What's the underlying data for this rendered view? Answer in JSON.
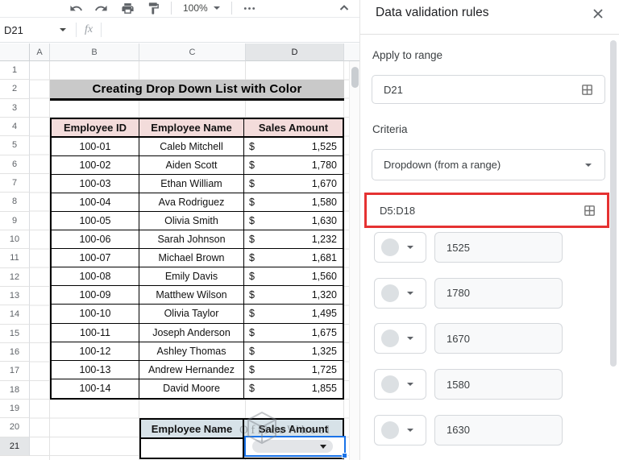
{
  "toolbar": {
    "zoom_value": "100%"
  },
  "name_box": {
    "value": "D21"
  },
  "formula_bar": {
    "fx_label": "fx"
  },
  "colors": {
    "selection_blue": "#1a73e8",
    "accent_red": "#e53232",
    "pink_header": "#f3dcdb",
    "blue_header": "#d7e2e8",
    "title_gray": "#c9c9c9"
  },
  "sheet": {
    "columns": [
      "A",
      "B",
      "C",
      "D"
    ],
    "row_numbers": [
      "1",
      "2",
      "3",
      "4",
      "5",
      "6",
      "7",
      "8",
      "9",
      "10",
      "11",
      "12",
      "13",
      "14",
      "15",
      "16",
      "17",
      "18",
      "19",
      "20",
      "21"
    ],
    "selected_cell": "D21",
    "title": "Creating Drop Down List with Color",
    "main_table": {
      "headers": [
        "Employee ID",
        "Employee Name",
        "Sales Amount"
      ],
      "currency_symbol": "$",
      "rows": [
        [
          "100-01",
          "Caleb Mitchell",
          "1,525"
        ],
        [
          "100-02",
          "Aiden Scott",
          "1,780"
        ],
        [
          "100-03",
          "Ethan William",
          "1,670"
        ],
        [
          "100-04",
          "Ava Rodriguez",
          "1,580"
        ],
        [
          "100-05",
          "Olivia Smith",
          "1,630"
        ],
        [
          "100-06",
          "Sarah Johnson",
          "1,232"
        ],
        [
          "100-07",
          "Michael Brown",
          "1,681"
        ],
        [
          "100-08",
          "Emily Davis",
          "1,560"
        ],
        [
          "100-09",
          "Matthew Wilson",
          "1,320"
        ],
        [
          "100-10",
          "Olivia Taylor",
          "1,495"
        ],
        [
          "100-11",
          "Joseph Anderson",
          "1,675"
        ],
        [
          "100-12",
          "Ashley Thomas",
          "1,325"
        ],
        [
          "100-13",
          "Andrew Hernandez",
          "1,725"
        ],
        [
          "100-14",
          "David Moore",
          "1,855"
        ]
      ]
    },
    "lookup_table": {
      "headers": [
        "Employee Name",
        "Sales Amount"
      ]
    },
    "watermark_text": "OfficeWheel"
  },
  "panel": {
    "title": "Data validation rules",
    "apply_to_range": {
      "label": "Apply to range",
      "value": "D21"
    },
    "criteria": {
      "label": "Criteria",
      "value": "Dropdown (from a range)"
    },
    "source_range": {
      "value": "D5:D18"
    },
    "items": [
      "1525",
      "1780",
      "1670",
      "1580",
      "1630"
    ]
  }
}
